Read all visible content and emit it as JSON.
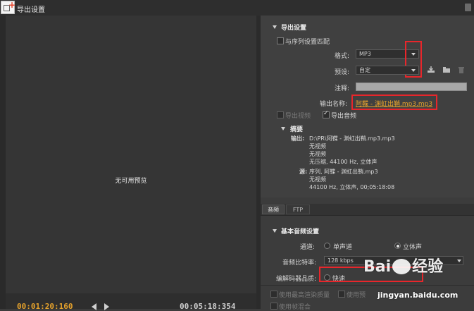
{
  "window": {
    "title": "导出设置"
  },
  "preview": {
    "message": "无可用预览",
    "timecode_in": "00:01:20:160",
    "timecode_out": "00:05:18:354"
  },
  "export_settings": {
    "header": "导出设置",
    "match_sequence_label": "与序列设置匹配",
    "format_label": "格式:",
    "format_value": "MP3",
    "preset_label": "预设:",
    "preset_value": "自定",
    "comment_label": "注释:",
    "comment_value": "",
    "output_name_label": "输出名称:",
    "output_name_value": "阿鞢 - 渊虹出鞘.mp3.mp3",
    "export_video_label": "导出视频",
    "export_audio_label": "导出音频",
    "export_video_checked": false,
    "export_audio_checked": true
  },
  "summary": {
    "header": "摘要",
    "output_label": "输出:",
    "output_lines": [
      "D:\\PR\\阿鞢 - 渊虹出鞘.mp3.mp3",
      "无视频",
      "无视频",
      "无压缩, 44100 Hz, 立体声"
    ],
    "source_label": "源:",
    "source_lines": [
      "序列, 阿鞢 - 渊虹出鞘.mp3",
      "无视频",
      "44100 Hz, 立体声, 00;05:18:08"
    ]
  },
  "tabs": [
    {
      "label": "音频",
      "active": true
    },
    {
      "label": "FTP",
      "active": false
    }
  ],
  "audio_basic": {
    "header": "基本音频设置",
    "channels_label": "通道:",
    "mono_label": "单声道",
    "stereo_label": "立体声",
    "selected_channel": "stereo",
    "bitrate_label": "音频比特率:",
    "bitrate_value": "128 kbps",
    "codec_quality_label": "编解码器品质:",
    "codec_quality_value": "快速"
  },
  "bottom": {
    "max_render_quality": "使用最高渲染质量",
    "use_preview": "使用预",
    "use_frame_blend": "使用帧混合"
  },
  "watermark": {
    "logo_text": "Bai",
    "logo_text2": "经验",
    "url": "jingyan.baidu.com"
  },
  "colors": {
    "accent_orange": "#e5a22c",
    "highlight_red": "#e8262b",
    "panel_bg": "#404040"
  }
}
